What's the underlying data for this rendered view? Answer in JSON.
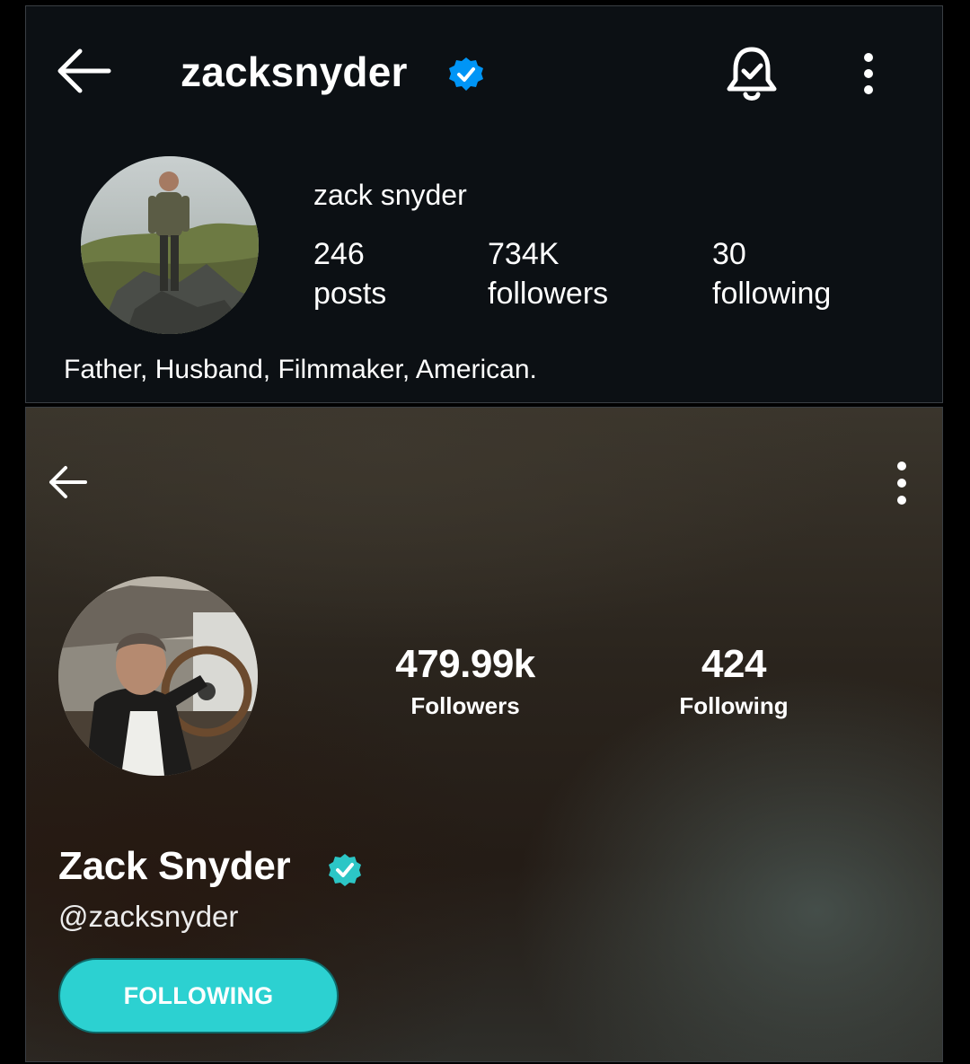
{
  "instagram_profile": {
    "username": "zacksnyder",
    "full_name": "zack snyder",
    "stats": [
      {
        "value": "246",
        "label": "posts"
      },
      {
        "value": "734K",
        "label": "followers"
      },
      {
        "value": "30",
        "label": "following"
      }
    ],
    "bio": "Father, Husband, Filmmaker, American.",
    "icons": {
      "back": "arrow-left-icon",
      "verified": "verified-badge-icon",
      "notifications": "bell-check-icon",
      "more": "more-vertical-icon"
    },
    "colors": {
      "background": "#0c1014",
      "verified": "#0095f6"
    }
  },
  "fan_profile": {
    "display_name": "Zack Snyder",
    "handle": "@zacksnyder",
    "stats": [
      {
        "value": "479.99k",
        "label": "Followers"
      },
      {
        "value": "424",
        "label": "Following"
      }
    ],
    "follow_button_label": "FOLLOWING",
    "icons": {
      "back": "arrow-left-icon",
      "verified": "verified-check-icon",
      "more": "more-vertical-icon"
    },
    "colors": {
      "accent": "#2cd1d1",
      "verified": "#2cc6c6"
    }
  }
}
